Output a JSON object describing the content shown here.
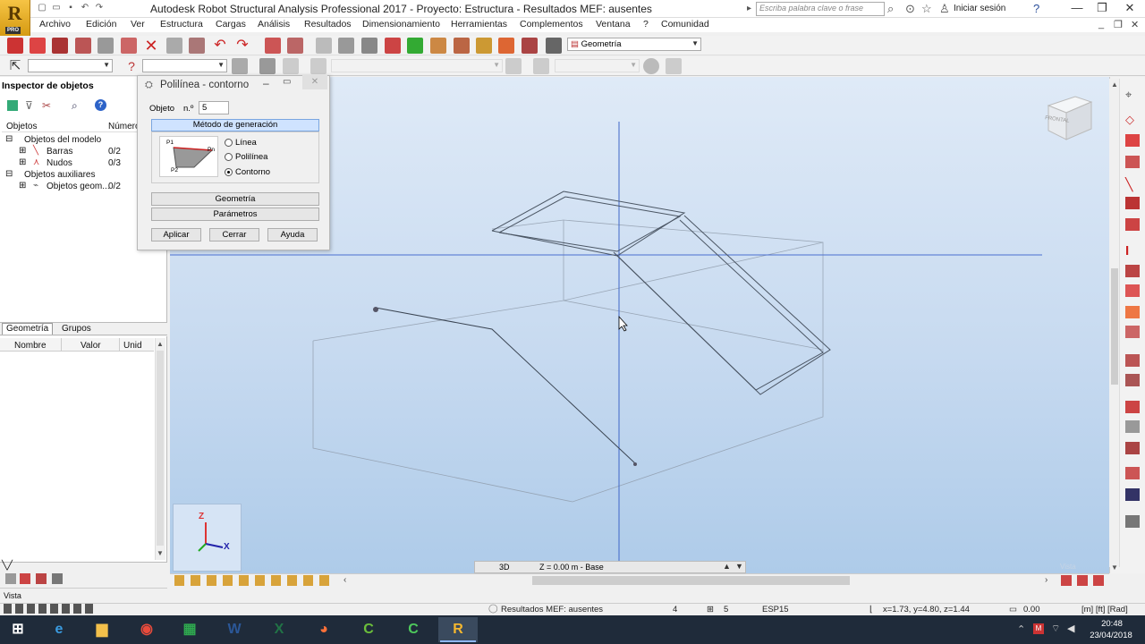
{
  "app": {
    "title": "Autodesk Robot Structural Analysis Professional 2017 - Proyecto: Estructura - Resultados MEF: ausentes",
    "logo_letter": "R",
    "logo_badge": "PRO",
    "search_placeholder": "Escriba palabra clave o frase",
    "signin": "Iniciar sesión"
  },
  "menu": [
    "Archivo",
    "Edición",
    "Ver",
    "Estructura",
    "Cargas",
    "Análisis",
    "Resultados",
    "Dimensionamiento",
    "Herramientas",
    "Complementos",
    "Ventana",
    "?",
    "Comunidad"
  ],
  "toolbar": {
    "view_select": "Geometría"
  },
  "inspector": {
    "title": "Inspector de objetos",
    "col_objects": "Objetos",
    "col_number": "Número",
    "tree": [
      {
        "label": "Objetos del modelo",
        "value": ""
      },
      {
        "label": "Barras",
        "value": "0/2"
      },
      {
        "label": "Nudos",
        "value": "0/3"
      },
      {
        "label": "Objetos auxiliares",
        "value": ""
      },
      {
        "label": "Objetos geom...",
        "value": "0/2"
      }
    ],
    "tabs": [
      "Geometría",
      "Grupos"
    ]
  },
  "props": {
    "columns": [
      "Nombre",
      "Valor",
      "Unid"
    ]
  },
  "dialog": {
    "title": "Polilínea - contorno",
    "object_label": "Objeto",
    "number_label": "n.º",
    "number_value": "5",
    "method_header": "Método de generación",
    "p1": "P1",
    "pn": "Pn",
    "p2": "P2",
    "options": [
      "Línea",
      "Polilínea",
      "Contorno"
    ],
    "selected": 2,
    "section_geometry": "Geometría",
    "section_params": "Parámetros",
    "btn_apply": "Aplicar",
    "btn_close": "Cerrar",
    "btn_help": "Ayuda"
  },
  "viewport": {
    "view_mode": "3D",
    "level": "Z = 0.00 m - Base",
    "viewcube_label": "FRONTAL",
    "axis_z": "Z",
    "axis_x": "X",
    "watermark": "Vista"
  },
  "bottom_panel": {
    "label": "Vista"
  },
  "status": {
    "results": "Resultados MEF: ausentes",
    "field1": "4",
    "field2": "5",
    "section": "ESP15",
    "coords": "x=1.73, y=4.80, z=1.44",
    "angle": "0.00",
    "units": "[m] [ft] [Rad]"
  },
  "clock": {
    "time": "20:48",
    "date": "23/04/2018"
  },
  "colors": {
    "accent": "#f5b72e",
    "viewport_top": "#dfeaf7",
    "viewport_bottom": "#aecbe9",
    "selection": "#cfe3ff"
  }
}
